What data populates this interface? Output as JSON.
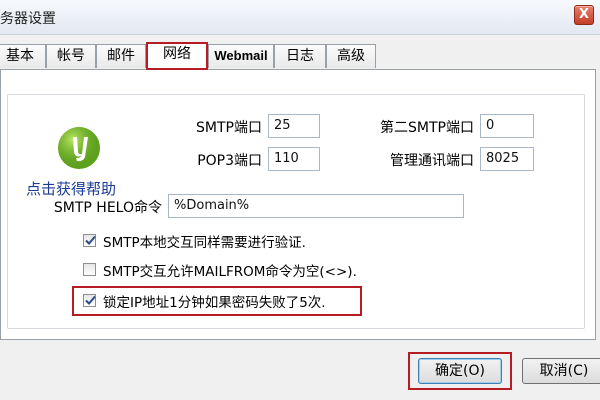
{
  "window": {
    "title": "务器设置",
    "close_label": "X"
  },
  "tabs": [
    {
      "label": "基本"
    },
    {
      "label": "帐号"
    },
    {
      "label": "邮件"
    },
    {
      "label": "网络"
    },
    {
      "label": "Webmail"
    },
    {
      "label": "日志"
    },
    {
      "label": "高级"
    }
  ],
  "active_tab": "网络",
  "help": {
    "label": "点击获得帮助",
    "logo_icon": "green-help-globe-icon"
  },
  "fields": {
    "smtp_port": {
      "label": "SMTP端口",
      "value": "25"
    },
    "pop3_port": {
      "label": "POP3端口",
      "value": "110"
    },
    "second_smtp_port": {
      "label": "第二SMTP端口",
      "value": "0"
    },
    "admin_port": {
      "label": "管理通讯端口",
      "value": "8025"
    },
    "helo": {
      "label": "SMTP HELO命令",
      "value": "%Domain%"
    }
  },
  "checkboxes": [
    {
      "label": "SMTP本地交互同样需要进行验证.",
      "checked": true
    },
    {
      "label": "SMTP交互允许MAILFROM命令为空(<>).",
      "checked": false
    },
    {
      "label": "锁定IP地址1分钟如果密码失败了5次.",
      "checked": true
    }
  ],
  "buttons": {
    "ok": "确定(O)",
    "cancel": "取消(C)"
  },
  "colors": {
    "highlight": "#b51d23",
    "link": "#1a3a96",
    "logo": "#5ea41c"
  }
}
